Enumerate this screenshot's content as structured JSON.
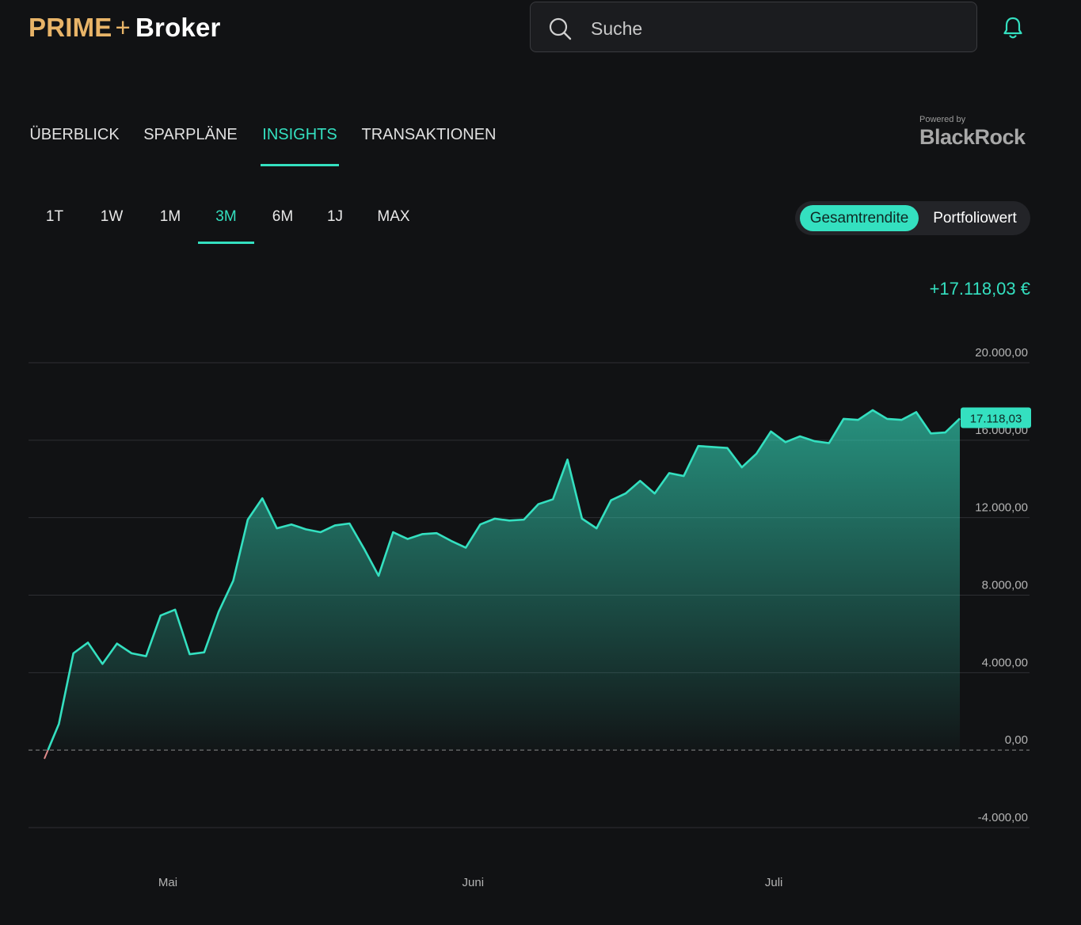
{
  "header": {
    "logo": {
      "prime": "PRIME",
      "plus": "+",
      "broker": "Broker"
    },
    "search": {
      "placeholder": "Suche",
      "value": ""
    },
    "icons": {
      "search": "search-icon",
      "notifications": "bell-icon"
    }
  },
  "tabs": [
    {
      "label": "ÜBERBLICK",
      "active": false
    },
    {
      "label": "SPARPLÄNE",
      "active": false
    },
    {
      "label": "INSIGHTS",
      "active": true
    },
    {
      "label": "TRANSAKTIONEN",
      "active": false
    }
  ],
  "powered_by": {
    "label": "Powered by",
    "brand": "BlackRock"
  },
  "ranges": [
    {
      "label": "1T",
      "active": false
    },
    {
      "label": "1W",
      "active": false
    },
    {
      "label": "1M",
      "active": false
    },
    {
      "label": "3M",
      "active": true
    },
    {
      "label": "6M",
      "active": false
    },
    {
      "label": "1J",
      "active": false
    },
    {
      "label": "MAX",
      "active": false
    }
  ],
  "view_toggle": {
    "selected": "Gesamtrendite",
    "other": "Portfoliowert"
  },
  "total_return": "+17.118,03 €",
  "colors": {
    "accent": "#34e0c0",
    "background": "#111214",
    "logo_gold": "#e8b468",
    "negative": "#e08a8a"
  },
  "chart_data": {
    "type": "area",
    "ylim": [
      -4000,
      20000
    ],
    "y_ticks": [
      20000,
      16000,
      12000,
      8000,
      4000,
      0,
      -4000
    ],
    "y_tick_labels": [
      "20.000,00",
      "16.000,00",
      "12.000,00",
      "8.000,00",
      "4.000,00",
      "0,00",
      "-4.000,00"
    ],
    "x_labels": [
      "Mai",
      "Juni",
      "Juli"
    ],
    "x_label_index": [
      8.5,
      29.5,
      50.2
    ],
    "current_value_label": "17.118,03",
    "values": [
      -450,
      1350,
      5000,
      5550,
      4450,
      5500,
      5000,
      4850,
      6950,
      7250,
      4950,
      5050,
      7150,
      8750,
      11900,
      13000,
      11450,
      11650,
      11400,
      11250,
      11600,
      11700,
      10400,
      9000,
      11250,
      10900,
      11150,
      11200,
      10800,
      10450,
      11650,
      11950,
      11850,
      11900,
      12700,
      12950,
      15000,
      11950,
      11450,
      12900,
      13250,
      13900,
      13250,
      14300,
      14150,
      15700,
      15650,
      15600,
      14600,
      15300,
      16450,
      15900,
      16200,
      15950,
      15850,
      17100,
      17050,
      17550,
      17100,
      17050,
      17450,
      16350,
      16400,
      17118
    ]
  }
}
